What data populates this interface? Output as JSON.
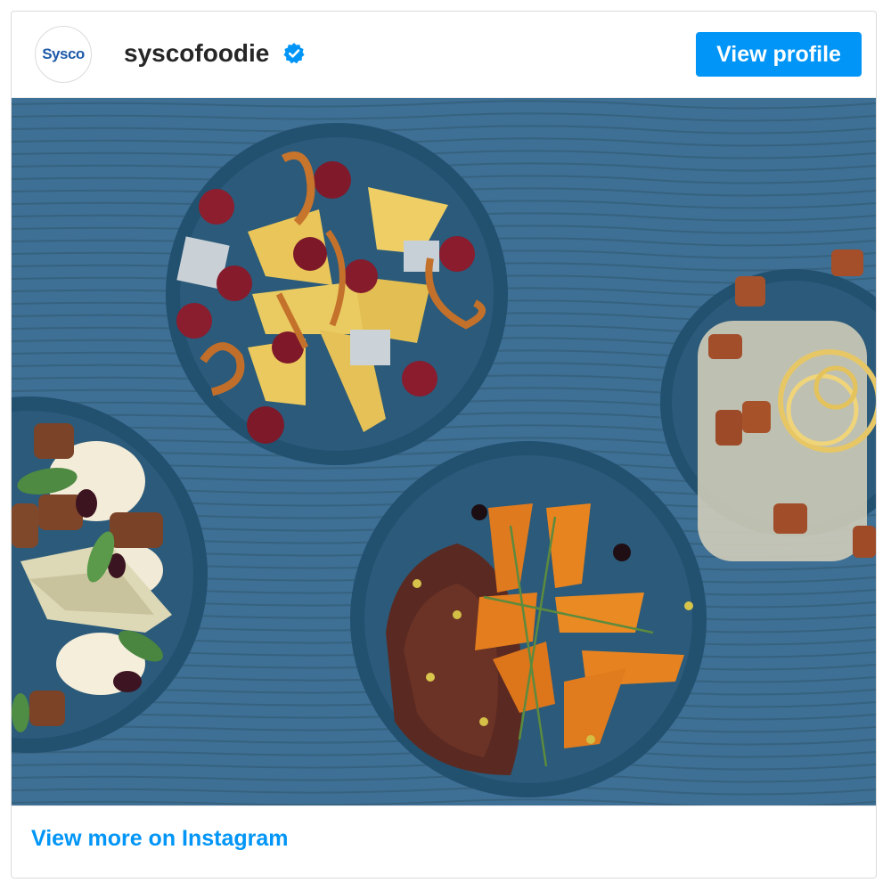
{
  "post": {
    "avatar_text": "Sysco",
    "username": "syscofoodie",
    "view_profile_label": "View profile",
    "view_more_label": "View more on Instagram"
  },
  "icons": {
    "verified": "verified-badge-icon"
  },
  "colors": {
    "accent": "#0095f6",
    "background_table": "#3e6f94",
    "plate": "#2a5676",
    "username_text": "#262626"
  }
}
